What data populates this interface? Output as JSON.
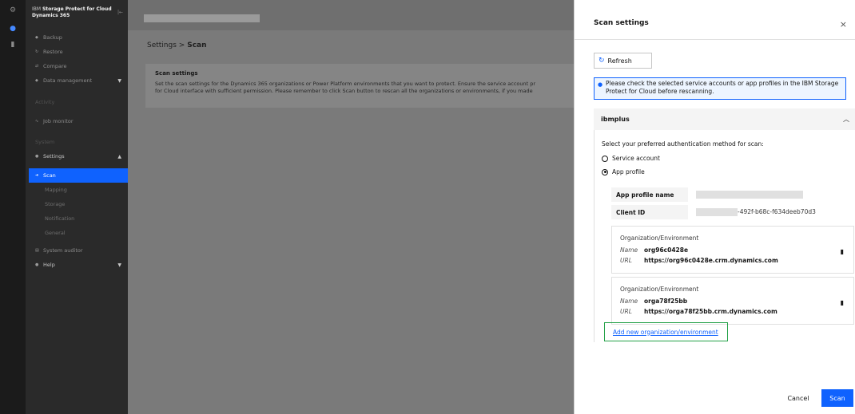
{
  "app": {
    "title_brand": "IBM",
    "title_name": "Storage Protect for Cloud",
    "title_product": "Dynamics 365",
    "collapse_glyph": "|←"
  },
  "sidebar": {
    "items": [
      {
        "label": "Backup",
        "icon": "backup-icon"
      },
      {
        "label": "Restore",
        "icon": "restore-icon"
      },
      {
        "label": "Compare",
        "icon": "compare-icon"
      },
      {
        "label": "Data management",
        "icon": "data-icon"
      }
    ],
    "section_activity": "Activity",
    "job_monitor": "Job monitor",
    "section_system": "System",
    "settings": "Settings",
    "settings_sub": [
      "Scan",
      "Mapping",
      "Storage",
      "Notification",
      "General"
    ],
    "system_auditor": "System auditor",
    "help": "Help"
  },
  "main": {
    "breadcrumb_parent": "Settings",
    "breadcrumb_sep": ">",
    "breadcrumb_current": "Scan",
    "card_title": "Scan settings",
    "card_line1": "Set the scan settings for the Dynamics 365 organizations or Power Platform environments that you want to protect. Ensure the service account pr",
    "card_line2": "for Cloud interface with sufficient permission. Please remember to click Scan button to rescan all the organizations or environments, if you made"
  },
  "panel": {
    "title": "Scan settings",
    "close": "×",
    "refresh": "Refresh",
    "notice": "Please check the selected service accounts or app profiles in the IBM Storage Protect for Cloud before rescanning.",
    "accordion_title": "ibmplus",
    "auth_question": "Select your preferred authentication method for scan:",
    "option_service": "Service account",
    "option_app": "App profile",
    "app_profile_label": "App profile name",
    "client_id_label": "Client ID",
    "client_id_value": "-492f-b68c-f634deeb70d3",
    "orgs": [
      {
        "heading": "Organization/Environment",
        "name_key": "Name",
        "name": "org96c0428e",
        "url_key": "URL",
        "url": "https://org96c0428e.crm.dynamics.com"
      },
      {
        "heading": "Organization/Environment",
        "name_key": "Name",
        "name": "orga78f25bb",
        "url_key": "URL",
        "url": "https://orga78f25bb.crm.dynamics.com"
      }
    ],
    "add_link": "Add new organization/environment",
    "cancel": "Cancel",
    "scan": "Scan"
  },
  "colors": {
    "primary": "#0f62fe",
    "highlight_border": "#24a148"
  }
}
